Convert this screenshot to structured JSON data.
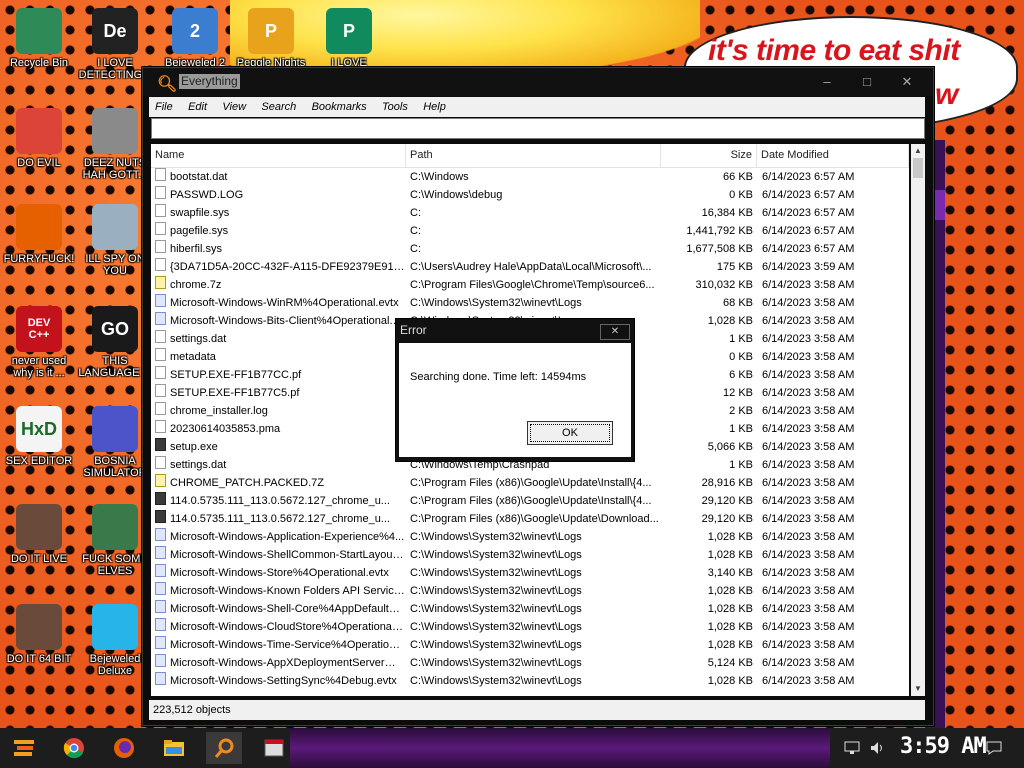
{
  "wallpaper": {
    "speech_line1": "it's time to eat shit",
    "speech_line2": "w"
  },
  "desktop_icons": [
    {
      "label": "Recycle Bin",
      "icon": "recycle-bin-icon",
      "color": "#2e8b57"
    },
    {
      "label": "I LOVE DETECTING...",
      "icon": "de-icon",
      "color": "#222222",
      "glyph": "De"
    },
    {
      "label": "Bejeweled 2",
      "icon": "bejeweled-icon",
      "color": "#3b7ecf",
      "glyph": "2"
    },
    {
      "label": "Peggle Nights",
      "icon": "peggle-icon",
      "color": "#e8a21c",
      "glyph": "P"
    },
    {
      "label": "I LOVE",
      "icon": "publisher-icon",
      "color": "#118a5e",
      "glyph": "P"
    },
    {
      "label": "DO EVIL",
      "icon": "chrome-icon",
      "color": "#db4437"
    },
    {
      "label": "DEEZ NUTS HAH GOTT...",
      "icon": "copy-icon",
      "color": "#8a8a8a"
    },
    {
      "label": "FURRYFUCK!",
      "icon": "firefox-icon",
      "color": "#e66000"
    },
    {
      "label": "ILL SPY ON YOU",
      "icon": "spy-icon",
      "color": "#9ab0c0"
    },
    {
      "label": "never used why is it ...",
      "icon": "devcpp-icon",
      "color": "#c4121c",
      "glyph": "DEV C++"
    },
    {
      "label": "THIS LANGUAGE ...",
      "icon": "goland-icon",
      "color": "#1a1a1a",
      "glyph": "GO"
    },
    {
      "label": "SEX EDITOR",
      "icon": "hxd-icon",
      "color": "#f4f4f4",
      "glyph": "HxD"
    },
    {
      "label": "BOSNIA SIMULATOR",
      "icon": "mine-icon",
      "color": "#4b54c8"
    },
    {
      "label": "DO IT LIVE",
      "icon": "portrait-icon",
      "color": "#6a4a3a"
    },
    {
      "label": "FUCK SOME ELVES",
      "icon": "elf-icon",
      "color": "#3a7a4a"
    },
    {
      "label": "DO IT 64 BIT",
      "icon": "portrait-64-icon",
      "color": "#6a4a3a"
    },
    {
      "label": "Bejeweled Deluxe",
      "icon": "diamond-icon",
      "color": "#27b4e8"
    }
  ],
  "window": {
    "title": "Everything",
    "menu": [
      "File",
      "Edit",
      "View",
      "Search",
      "Bookmarks",
      "Tools",
      "Help"
    ],
    "search_value": "",
    "columns": {
      "name": "Name",
      "path": "Path",
      "size": "Size",
      "date": "Date Modified"
    },
    "rows": [
      {
        "name": "bootstat.dat",
        "path": "C:\\Windows",
        "size": "66 KB",
        "date": "6/14/2023 6:57 AM",
        "type": "file"
      },
      {
        "name": "PASSWD.LOG",
        "path": "C:\\Windows\\debug",
        "size": "0 KB",
        "date": "6/14/2023 6:57 AM",
        "type": "file"
      },
      {
        "name": "swapfile.sys",
        "path": "C:",
        "size": "16,384 KB",
        "date": "6/14/2023 6:57 AM",
        "type": "file"
      },
      {
        "name": "pagefile.sys",
        "path": "C:",
        "size": "1,441,792 KB",
        "date": "6/14/2023 6:57 AM",
        "type": "file"
      },
      {
        "name": "hiberfil.sys",
        "path": "C:",
        "size": "1,677,508 KB",
        "date": "6/14/2023 6:57 AM",
        "type": "file"
      },
      {
        "name": "{3DA71D5A-20CC-432F-A115-DFE92379E91F}...",
        "path": "C:\\Users\\Audrey Hale\\AppData\\Local\\Microsoft\\...",
        "size": "175 KB",
        "date": "6/14/2023 3:59 AM",
        "type": "file"
      },
      {
        "name": "chrome.7z",
        "path": "C:\\Program Files\\Google\\Chrome\\Temp\\source6...",
        "size": "310,032 KB",
        "date": "6/14/2023 3:58 AM",
        "type": "zip"
      },
      {
        "name": "Microsoft-Windows-WinRM%4Operational.evtx",
        "path": "C:\\Windows\\System32\\winevt\\Logs",
        "size": "68 KB",
        "date": "6/14/2023 3:58 AM",
        "type": "evtx"
      },
      {
        "name": "Microsoft-Windows-Bits-Client%4Operational.evtx",
        "path": "C:\\Windows\\System32\\winevt\\Logs",
        "size": "1,028 KB",
        "date": "6/14/2023 3:58 AM",
        "type": "evtx"
      },
      {
        "name": "settings.dat",
        "path": "",
        "size": "1 KB",
        "date": "6/14/2023 3:58 AM",
        "type": "file"
      },
      {
        "name": "metadata",
        "path": "",
        "size": "0 KB",
        "date": "6/14/2023 3:58 AM",
        "type": "file"
      },
      {
        "name": "SETUP.EXE-FF1B77CC.pf",
        "path": "",
        "size": "6 KB",
        "date": "6/14/2023 3:58 AM",
        "type": "file"
      },
      {
        "name": "SETUP.EXE-FF1B77C5.pf",
        "path": "",
        "size": "12 KB",
        "date": "6/14/2023 3:58 AM",
        "type": "file"
      },
      {
        "name": "chrome_installer.log",
        "path": "",
        "size": "2 KB",
        "date": "6/14/2023 3:58 AM",
        "type": "file"
      },
      {
        "name": "20230614035853.pma",
        "path": "",
        "size": "1 KB",
        "date": "6/14/2023 3:58 AM",
        "type": "file"
      },
      {
        "name": "setup.exe",
        "path": "",
        "size": "5,066 KB",
        "date": "6/14/2023 3:58 AM",
        "type": "exe"
      },
      {
        "name": "settings.dat",
        "path": "C:\\Windows\\Temp\\Crashpad",
        "size": "1 KB",
        "date": "6/14/2023 3:58 AM",
        "type": "file"
      },
      {
        "name": "CHROME_PATCH.PACKED.7Z",
        "path": "C:\\Program Files (x86)\\Google\\Update\\Install\\{4...",
        "size": "28,916 KB",
        "date": "6/14/2023 3:58 AM",
        "type": "zip"
      },
      {
        "name": "114.0.5735.111_113.0.5672.127_chrome_u...",
        "path": "C:\\Program Files (x86)\\Google\\Update\\Install\\{4...",
        "size": "29,120 KB",
        "date": "6/14/2023 3:58 AM",
        "type": "exe"
      },
      {
        "name": "114.0.5735.111_113.0.5672.127_chrome_u...",
        "path": "C:\\Program Files (x86)\\Google\\Update\\Download...",
        "size": "29,120 KB",
        "date": "6/14/2023 3:58 AM",
        "type": "exe"
      },
      {
        "name": "Microsoft-Windows-Application-Experience%4...",
        "path": "C:\\Windows\\System32\\winevt\\Logs",
        "size": "1,028 KB",
        "date": "6/14/2023 3:58 AM",
        "type": "evtx"
      },
      {
        "name": "Microsoft-Windows-ShellCommon-StartLayoutP...",
        "path": "C:\\Windows\\System32\\winevt\\Logs",
        "size": "1,028 KB",
        "date": "6/14/2023 3:58 AM",
        "type": "evtx"
      },
      {
        "name": "Microsoft-Windows-Store%4Operational.evtx",
        "path": "C:\\Windows\\System32\\winevt\\Logs",
        "size": "3,140 KB",
        "date": "6/14/2023 3:58 AM",
        "type": "evtx"
      },
      {
        "name": "Microsoft-Windows-Known Folders API Service...",
        "path": "C:\\Windows\\System32\\winevt\\Logs",
        "size": "1,028 KB",
        "date": "6/14/2023 3:58 AM",
        "type": "evtx"
      },
      {
        "name": "Microsoft-Windows-Shell-Core%4AppDefaults....",
        "path": "C:\\Windows\\System32\\winevt\\Logs",
        "size": "1,028 KB",
        "date": "6/14/2023 3:58 AM",
        "type": "evtx"
      },
      {
        "name": "Microsoft-Windows-CloudStore%4Operational....",
        "path": "C:\\Windows\\System32\\winevt\\Logs",
        "size": "1,028 KB",
        "date": "6/14/2023 3:58 AM",
        "type": "evtx"
      },
      {
        "name": "Microsoft-Windows-Time-Service%4Operationa...",
        "path": "C:\\Windows\\System32\\winevt\\Logs",
        "size": "1,028 KB",
        "date": "6/14/2023 3:58 AM",
        "type": "evtx"
      },
      {
        "name": "Microsoft-Windows-AppXDeploymentServer%4...",
        "path": "C:\\Windows\\System32\\winevt\\Logs",
        "size": "5,124 KB",
        "date": "6/14/2023 3:58 AM",
        "type": "evtx"
      },
      {
        "name": "Microsoft-Windows-SettingSync%4Debug.evtx",
        "path": "C:\\Windows\\System32\\winevt\\Logs",
        "size": "1,028 KB",
        "date": "6/14/2023 3:58 AM",
        "type": "evtx"
      }
    ],
    "status": "223,512 objects"
  },
  "dialog": {
    "title": "Error",
    "message": "Searching done. Time left: 14594ms",
    "ok_label": "OK"
  },
  "taskbar": {
    "items": [
      "start-icon",
      "chrome-icon",
      "firefox-icon",
      "file-explorer-icon",
      "everything-icon",
      "app-window-icon"
    ],
    "clock": "3:59 AM"
  }
}
